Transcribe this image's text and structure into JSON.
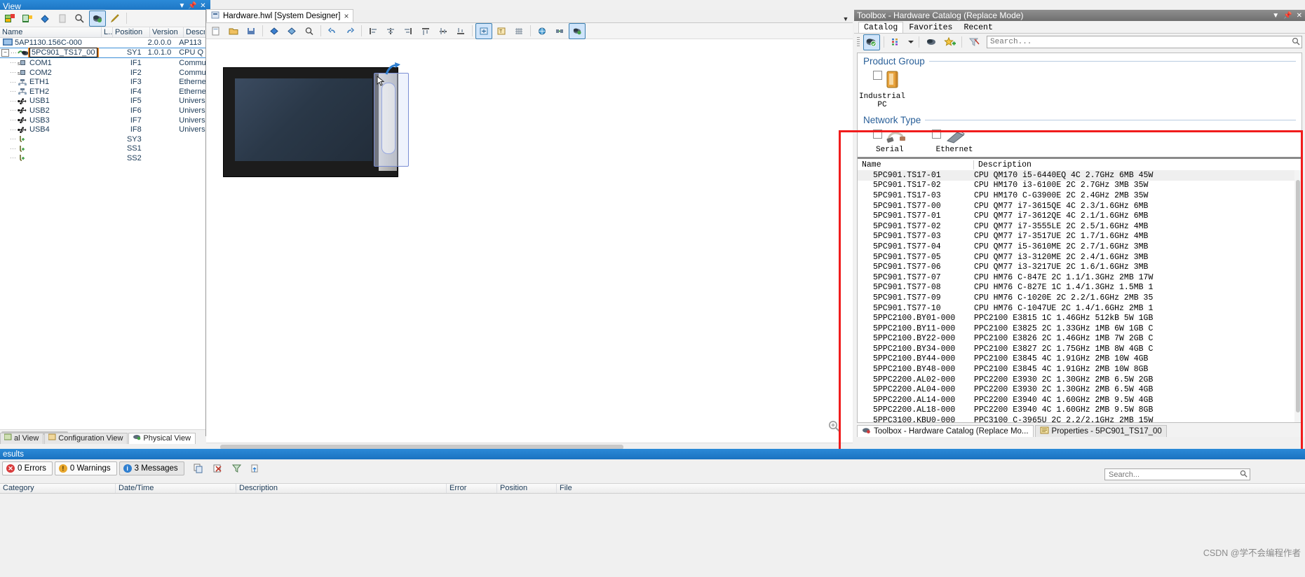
{
  "left_panel": {
    "title": "View",
    "title_buttons": [
      "chevron-down",
      "pin",
      "close"
    ],
    "toolbar_icons": [
      "add-hardware-icon",
      "add-object-icon",
      "diamond-icon",
      "page-icon",
      "search-module-icon",
      "physical-view-icon",
      "edit-icon"
    ],
    "columns": [
      "Name",
      "L...",
      "Position",
      "Version",
      "Descrip"
    ],
    "rows": [
      {
        "name": "5AP1130.156C-000",
        "pos": "",
        "version": "2.0.0.0",
        "desc": "AP113",
        "icon": "display-icon",
        "level": 0
      },
      {
        "name": "5PC901_TS17_00",
        "pos": "SY1",
        "version": "1.0.1.0",
        "desc": "CPU Q",
        "icon": "cpu-icon",
        "level": 0,
        "selected": true
      },
      {
        "name": "COM1",
        "pos": "IF1",
        "version": "",
        "desc": "Commu",
        "icon": "serial-icon",
        "level": 1
      },
      {
        "name": "COM2",
        "pos": "IF2",
        "version": "",
        "desc": "Commu",
        "icon": "serial-icon",
        "level": 1
      },
      {
        "name": "ETH1",
        "pos": "IF3",
        "version": "",
        "desc": "Etherne",
        "icon": "ethernet-icon",
        "level": 1
      },
      {
        "name": "ETH2",
        "pos": "IF4",
        "version": "",
        "desc": "Etherne",
        "icon": "ethernet-icon",
        "level": 1
      },
      {
        "name": "USB1",
        "pos": "IF5",
        "version": "",
        "desc": "Univers",
        "icon": "usb-icon",
        "level": 1
      },
      {
        "name": "USB2",
        "pos": "IF6",
        "version": "",
        "desc": "Univers",
        "icon": "usb-icon",
        "level": 1
      },
      {
        "name": "USB3",
        "pos": "IF7",
        "version": "",
        "desc": "Univers",
        "icon": "usb-icon",
        "level": 1
      },
      {
        "name": "USB4",
        "pos": "IF8",
        "version": "",
        "desc": "Univers",
        "icon": "usb-icon",
        "level": 1
      },
      {
        "name": "",
        "pos": "SY3",
        "version": "",
        "desc": "",
        "icon": "slot-icon",
        "level": 1
      },
      {
        "name": "",
        "pos": "SS1",
        "version": "",
        "desc": "",
        "icon": "slot-icon",
        "level": 1
      },
      {
        "name": "",
        "pos": "SS2",
        "version": "",
        "desc": "",
        "icon": "slot-icon",
        "level": 1
      }
    ],
    "view_tabs": [
      {
        "label": "al View",
        "active": false
      },
      {
        "label": "Configuration View",
        "active": false
      },
      {
        "label": "Physical View",
        "active": true
      }
    ]
  },
  "center": {
    "tab_label": "Hardware.hwl [System Designer]",
    "tab_close": "×",
    "tab_menu": "▼",
    "toolbar_icons": [
      "new-icon",
      "open-icon",
      "save-icon",
      "diamond-icon",
      "magnify-icon",
      "undo-icon",
      "redo-icon",
      "align-left-icon",
      "align-center-icon",
      "align-right-icon",
      "align-top-icon",
      "align-middle-icon",
      "align-bottom-icon",
      "zoom-fit-icon",
      "label-icon",
      "grid-icon",
      "globe-icon",
      "connect-icon",
      "physical-view-icon"
    ],
    "zoom_icon": "zoom-loupe-icon"
  },
  "toolbox": {
    "title": "Toolbox - Hardware Catalog (Replace Mode)",
    "title_buttons": [
      "chevron-down",
      "pin",
      "close"
    ],
    "tabs": [
      {
        "label": "Catalog",
        "active": true
      },
      {
        "label": "Favorites",
        "active": false
      },
      {
        "label": "Recent",
        "active": false
      }
    ],
    "toolbar_icons": [
      "replace-mode-icon",
      "columns-icon",
      "chevron-down-icon",
      "add-hardware-icon",
      "add-favorite-star-icon",
      "clear-filter-icon"
    ],
    "search": {
      "placeholder": "Search...",
      "value": "",
      "icon": "search-icon"
    },
    "product_group": {
      "title": "Product Group",
      "items": [
        {
          "label": "Industrial\nPC",
          "label_line1": "Industrial",
          "label_line2": "PC",
          "checked": false,
          "icon": "industrial-pc-icon"
        }
      ]
    },
    "network_type": {
      "title": "Network Type",
      "items": [
        {
          "label": "Serial",
          "checked": false,
          "icon": "serial-cable-icon"
        },
        {
          "label": "Ethernet",
          "checked": false,
          "icon": "ethernet-plug-icon"
        }
      ]
    },
    "list": {
      "columns": [
        "Name",
        "Description"
      ],
      "rows": [
        {
          "name": "5PC901.TS17-01",
          "description": "CPU QM170 i5-6440EQ 4C 2.7GHz 6MB 45W"
        },
        {
          "name": "5PC901.TS17-02",
          "description": "CPU HM170 i3-6100E 2C 2.7GHz 3MB 35W"
        },
        {
          "name": "5PC901.TS17-03",
          "description": "CPU HM170 C-G3900E 2C 2.4GHz 2MB 35W"
        },
        {
          "name": "5PC901.TS77-00",
          "description": "CPU QM77 i7-3615QE 4C 2.3/1.6GHz 6MB"
        },
        {
          "name": "5PC901.TS77-01",
          "description": "CPU QM77 i7-3612QE 4C 2.1/1.6GHz 6MB"
        },
        {
          "name": "5PC901.TS77-02",
          "description": "CPU QM77 i7-3555LE 2C 2.5/1.6GHz 4MB"
        },
        {
          "name": "5PC901.TS77-03",
          "description": "CPU QM77 i7-3517UE 2C 1.7/1.6GHz 4MB"
        },
        {
          "name": "5PC901.TS77-04",
          "description": "CPU QM77 i5-3610ME 2C 2.7/1.6GHz 3MB"
        },
        {
          "name": "5PC901.TS77-05",
          "description": "CPU QM77 i3-3120ME 2C 2.4/1.6GHz 3MB"
        },
        {
          "name": "5PC901.TS77-06",
          "description": "CPU QM77 i3-3217UE 2C 1.6/1.6GHz 3MB"
        },
        {
          "name": "5PC901.TS77-07",
          "description": "CPU HM76 C-847E 2C 1.1/1.3GHz 2MB 17W"
        },
        {
          "name": "5PC901.TS77-08",
          "description": "CPU HM76 C-827E 1C 1.4/1.3GHz 1.5MB 1"
        },
        {
          "name": "5PC901.TS77-09",
          "description": "CPU HM76 C-1020E 2C 2.2/1.6GHz 2MB 35"
        },
        {
          "name": "5PC901.TS77-10",
          "description": "CPU HM76 C-1047UE 2C 1.4/1.6GHz 2MB 1"
        },
        {
          "name": "5PPC2100.BY01-000",
          "description": "PPC2100 E3815 1C 1.46GHz 512kB 5W 1GB"
        },
        {
          "name": "5PPC2100.BY11-000",
          "description": "PPC2100 E3825 2C 1.33GHz 1MB 6W 1GB C"
        },
        {
          "name": "5PPC2100.BY22-000",
          "description": "PPC2100 E3826 2C 1.46GHz 1MB 7W 2GB C"
        },
        {
          "name": "5PPC2100.BY34-000",
          "description": "PPC2100 E3827 2C 1.75GHz 1MB 8W 4GB C"
        },
        {
          "name": "5PPC2100.BY44-000",
          "description": "PPC2100 E3845 4C 1.91GHz 2MB 10W 4GB"
        },
        {
          "name": "5PPC2100.BY48-000",
          "description": "PPC2100 E3845 4C 1.91GHz 2MB 10W 8GB"
        },
        {
          "name": "5PPC2200.AL02-000",
          "description": "PPC2200 E3930 2C 1.30GHz 2MB 6.5W 2GB"
        },
        {
          "name": "5PPC2200.AL04-000",
          "description": "PPC2200 E3930 2C 1.30GHz 2MB 6.5W 4GB"
        },
        {
          "name": "5PPC2200.AL14-000",
          "description": "PPC2200 E3940 4C 1.60GHz 2MB 9.5W 4GB"
        },
        {
          "name": "5PPC2200.AL18-000",
          "description": "PPC2200 E3940 4C 1.60GHz 2MB 9.5W 8GB"
        },
        {
          "name": "5PPC3100.KBU0-000",
          "description": "PPC3100 C-3965U 2C 2.2/2.1GHz 2MB 15W"
        }
      ]
    },
    "dock_tabs": [
      {
        "label": "Toolbox - Hardware Catalog (Replace Mo...",
        "active": true,
        "icon": "toolbox-icon"
      },
      {
        "label": "Properties - 5PC901_TS17_00",
        "active": false,
        "icon": "properties-icon"
      }
    ]
  },
  "output": {
    "title": "esults",
    "filters": [
      {
        "label": "0 Errors",
        "count": "0",
        "type": "err",
        "glyph": "✕",
        "active": false
      },
      {
        "label": "0 Warnings",
        "count": "0",
        "type": "warn",
        "glyph": "!",
        "active": false
      },
      {
        "label": "3 Messages",
        "count": "3",
        "type": "msg",
        "glyph": "i",
        "active": true
      }
    ],
    "action_icons": [
      "copy-icon",
      "clear-icon",
      "filter-icon",
      "goto-icon"
    ],
    "search": {
      "placeholder": "Search...",
      "value": "",
      "icon": "search-icon"
    },
    "columns": [
      "Category",
      "Date/Time",
      "Description",
      "Error",
      "Position",
      "File"
    ]
  },
  "watermark": "CSDN @学不会编程作者",
  "colors": {
    "title_blue": "#1a72c0",
    "accent_orange": "#e08327",
    "annotation_red": "#f01c1c",
    "link_blue": "#2a6099"
  }
}
